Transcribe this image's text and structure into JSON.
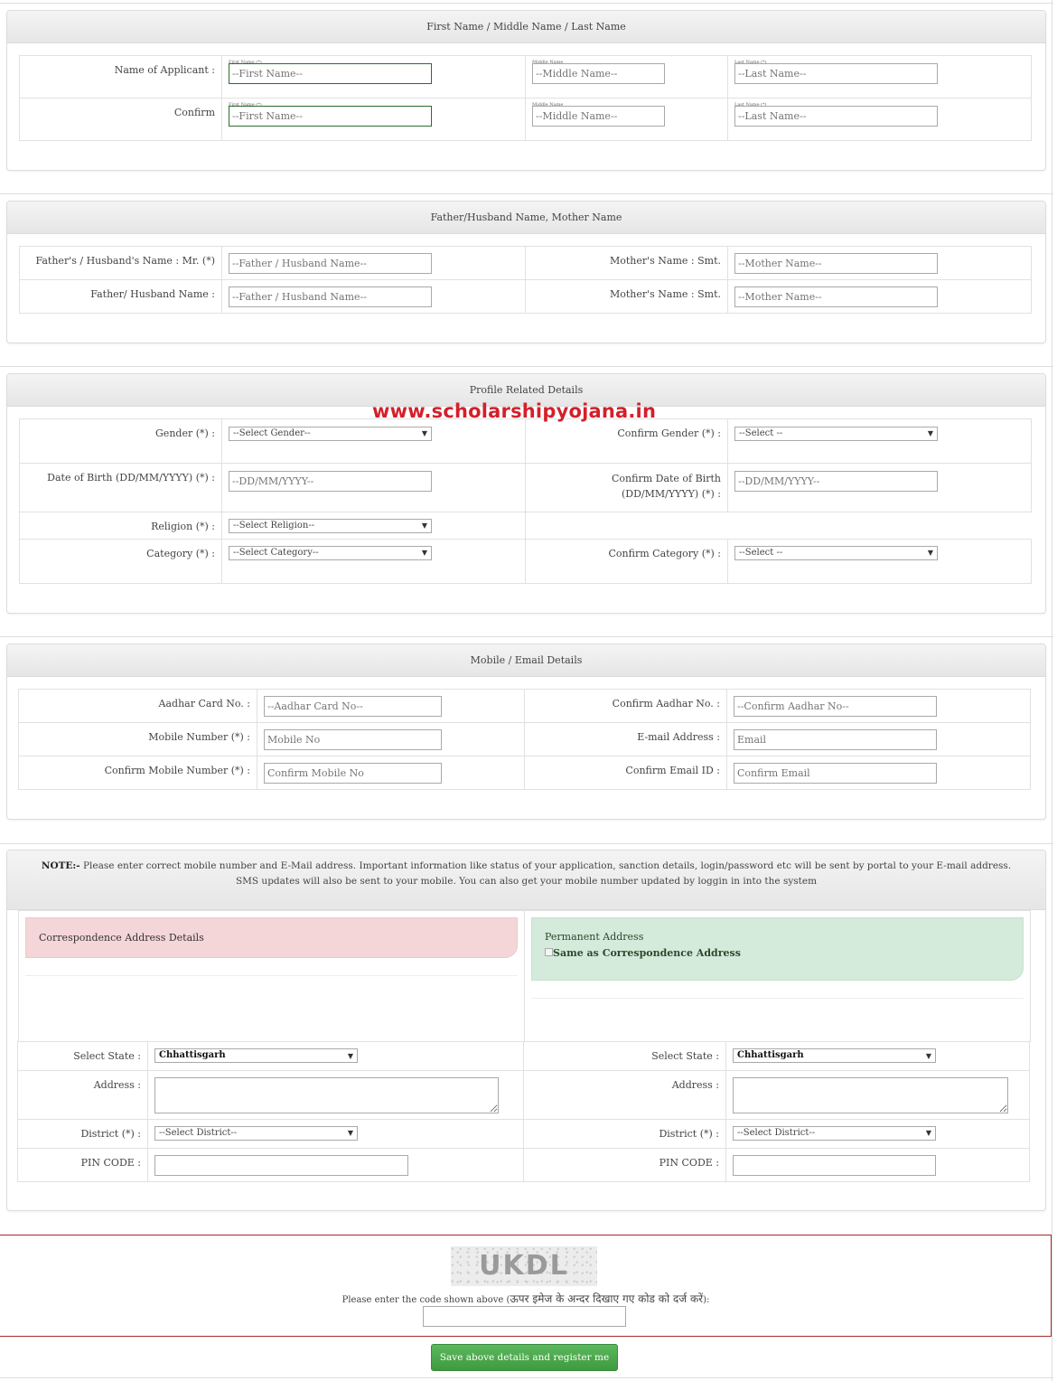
{
  "name_section": {
    "title": "First Name / Middle Name / Last Name",
    "rows": [
      {
        "label": "Name of Applicant :",
        "first_caption": "First Name (*)",
        "first_placeholder": "--First Name--",
        "middle_caption": "Middle Name",
        "middle_placeholder": "--Middle Name--",
        "last_caption": "Last Name (*)",
        "last_placeholder": "--Last Name--"
      },
      {
        "label": "Confirm",
        "first_caption": "First Name (*)",
        "first_placeholder": "--First Name--",
        "middle_caption": "Middle Name",
        "middle_placeholder": "--Middle Name--",
        "last_caption": "Last Name (*)",
        "last_placeholder": "--Last Name--"
      }
    ]
  },
  "parent_section": {
    "title": "Father/Husband Name, Mother Name",
    "rows": [
      {
        "father_label": "Father's / Husband's Name : Mr. (*)",
        "father_placeholder": "--Father / Husband Name--",
        "mother_label": "Mother's Name : Smt.",
        "mother_placeholder": "--Mother Name--"
      },
      {
        "father_label": "Father/ Husband Name :",
        "father_placeholder": "--Father / Husband Name--",
        "mother_label": "Mother's Name : Smt.",
        "mother_placeholder": "--Mother Name--"
      }
    ]
  },
  "profile_section": {
    "title": "Profile Related Details",
    "watermark": "www.scholarshipyojana.in",
    "gender_label": "Gender (*) :",
    "gender_value": "--Select Gender--",
    "confirm_gender_label": "Confirm Gender (*) :",
    "confirm_gender_value": "--Select --",
    "dob_label": "Date of Birth (DD/MM/YYYY) (*) :",
    "dob_placeholder": "--DD/MM/YYYY--",
    "confirm_dob_label": "Confirm Date of Birth (DD/MM/YYYY) (*) :",
    "confirm_dob_placeholder": "--DD/MM/YYYY--",
    "religion_label": "Religion (*) :",
    "religion_value": "--Select Religion--",
    "category_label": "Category (*) :",
    "category_value": "--Select Category--",
    "confirm_category_label": "Confirm Category (*) :",
    "confirm_category_value": "--Select --"
  },
  "contact_section": {
    "title": "Mobile / Email Details",
    "aadhar_label": "Aadhar Card No. :",
    "aadhar_placeholder": "--Aadhar Card No--",
    "confirm_aadhar_label": "Confirm Aadhar No. :",
    "confirm_aadhar_placeholder": "--Confirm Aadhar No--",
    "mobile_label": "Mobile Number (*) :",
    "mobile_placeholder": "Mobile No",
    "email_label": "E-mail Address :",
    "email_placeholder": "Email",
    "confirm_mobile_label": "Confirm Mobile Number (*) :",
    "confirm_mobile_placeholder": "Confirm Mobile No",
    "confirm_email_label": "Confirm Email ID :",
    "confirm_email_placeholder": "Confirm Email"
  },
  "address_section": {
    "note_bold": "NOTE:-",
    "note_text": " Please enter correct mobile number and E-Mail address. Important information like status of your application, sanction details, login/password etc will be sent by portal to your E-mail address. SMS updates will also be sent to your mobile. You can also get your mobile number updated by loggin in into the system",
    "correspondence_title": "Correspondence Address Details",
    "permanent_title": "Permanent Address",
    "same_as_label": "Same as Correspondence Address",
    "same_as_checked": false,
    "correspondence": {
      "state_label": "Select State :",
      "state_value": "Chhattisgarh",
      "address_label": "Address :",
      "address_value": "",
      "district_label": "District (*) :",
      "district_value": "--Select District--",
      "pin_label": "PIN CODE :",
      "pin_value": ""
    },
    "permanent": {
      "state_label": "Select State :",
      "state_value": "Chhattisgarh",
      "address_label": "Address :",
      "address_value": "",
      "district_label": "District (*) :",
      "district_value": "--Select District--",
      "pin_label": "PIN CODE :",
      "pin_value": ""
    }
  },
  "captcha": {
    "code": "UKDL",
    "prompt_en": "Please enter the code shown above (",
    "prompt_hi": "ऊपर इमेज के अन्दर दिखाए गए कोड को दर्ज करें",
    "prompt_end": "):",
    "value": ""
  },
  "submit": {
    "label": "Save above details and register me"
  },
  "colors": {
    "accent_green": "#5cb85c",
    "watermark_red": "#d51f2a",
    "captcha_border": "#a52a2a",
    "correspondence_bg": "#f5d6d8",
    "permanent_bg": "#d4eadb"
  }
}
